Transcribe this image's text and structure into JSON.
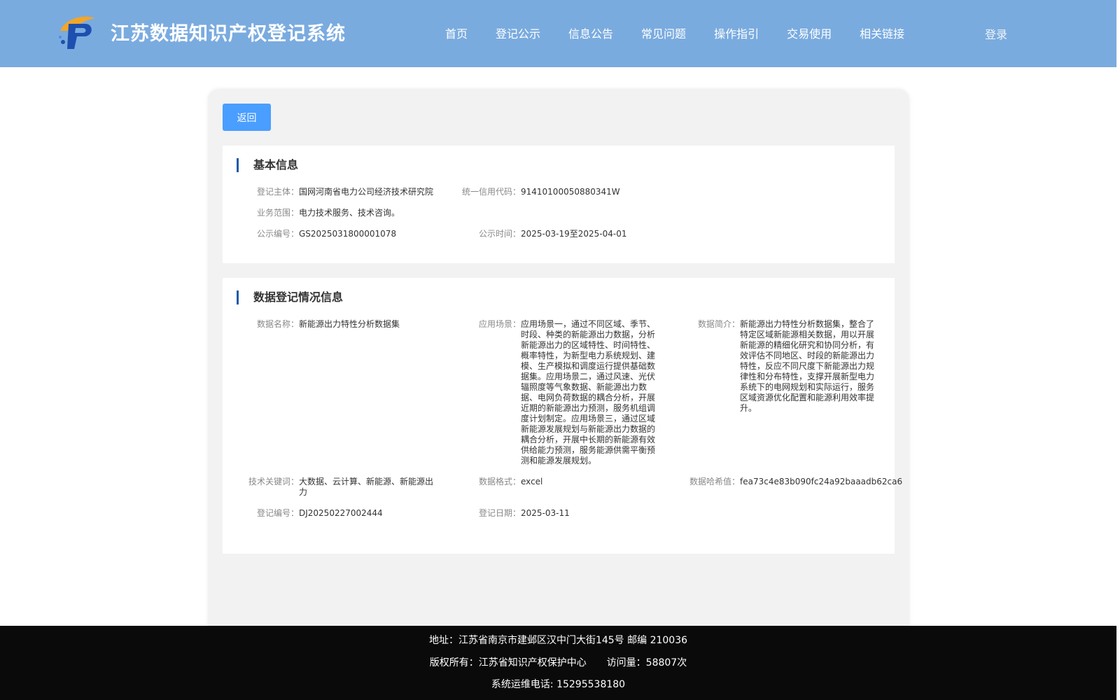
{
  "header": {
    "title": "江苏数据知识产权登记系统",
    "nav": [
      "首页",
      "登记公示",
      "信息公告",
      "常见问题",
      "操作指引",
      "交易使用",
      "相关链接"
    ],
    "login": "登录"
  },
  "back_label": "返回",
  "basic": {
    "title": "基本信息",
    "subject_label": "登记主体：",
    "subject": "国网河南省电力公司经济技术研究院",
    "credit_label": "统一信用代码：",
    "credit": "91410100050880341W",
    "scope_label": "业务范围：",
    "scope": "电力技术服务、技术咨询。",
    "notice_no_label": "公示编号：",
    "notice_no": "GS2025031800001078",
    "notice_time_label": "公示时间：",
    "notice_time": "2025-03-19至2025-04-01"
  },
  "registration": {
    "title": "数据登记情况信息",
    "name_label": "数据名称：",
    "name": "新能源出力特性分析数据集",
    "scenario_label": "应用场景：",
    "scenario": "应用场景一，通过不同区域、季节、时段、种类的新能源出力数据，分析新能源出力的区域特性、时间特性、概率特性，为新型电力系统规划、建模、生产模拟和调度运行提供基础数据集。应用场景二，通过风速、光伏辐照度等气象数据、新能源出力数据、电网负荷数据的耦合分析，开展近期的新能源出力预测，服务机组调度计划制定。应用场景三，通过区域新能源发展规划与新能源出力数据的耦合分析，开展中长期的新能源有效供给能力预测，服务能源供需平衡预测和能源发展规划。",
    "intro_label": "数据简介：",
    "intro": "新能源出力特性分析数据集，整合了特定区域新能源相关数据，用以开展新能源的精细化研究和协同分析，有效评估不同地区、时段的新能源出力特性，反应不同尺度下新能源出力规律性和分布特性，支撑开展新型电力系统下的电网规划和实际运行，服务区域资源优化配置和能源利用效率提升。",
    "keywords_label": "技术关键词：",
    "keywords": "大数据、云计算、新能源、新能源出力",
    "format_label": "数据格式：",
    "format": "excel",
    "hash_label": "数据哈希值：",
    "hash": "fea73c4e83b090fc24a92baaadb62ca6",
    "reg_no_label": "登记编号：",
    "reg_no": "DJ20250227002444",
    "reg_date_label": "登记日期：",
    "reg_date": "2025-03-11"
  },
  "footer": {
    "address": "地址：江苏省南京市建邺区汉中门大街145号 邮编 210036",
    "copyright": "版权所有：江苏省知识产权保护中心",
    "visits": "访问量：58807次",
    "phone": "系统运维电话: 15295538180"
  }
}
